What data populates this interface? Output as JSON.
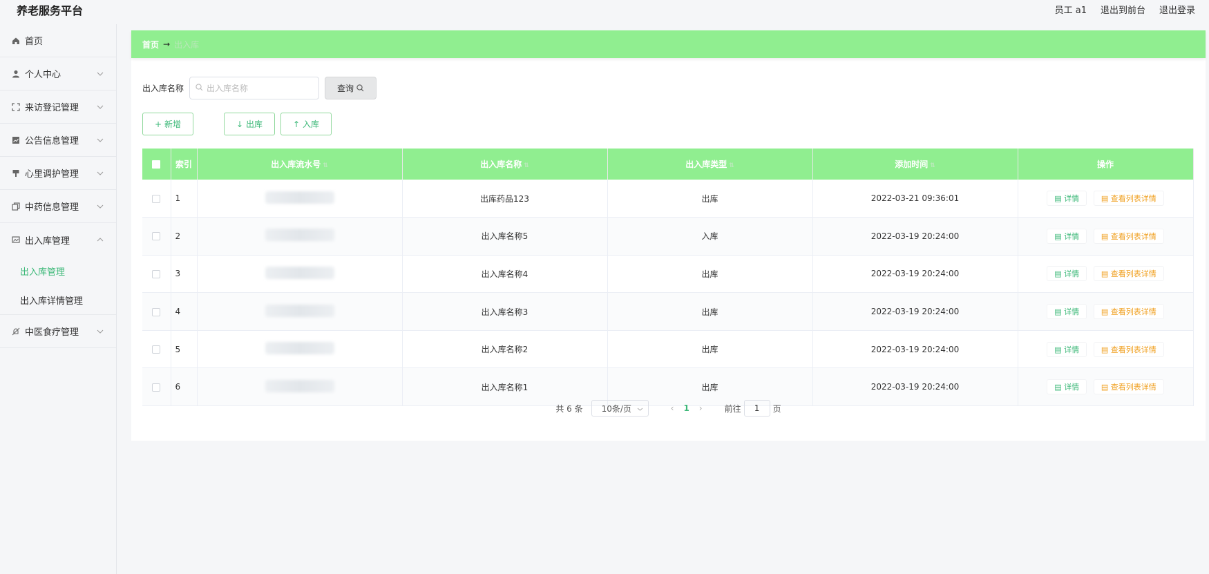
{
  "app": {
    "title": "养老服务平台",
    "user_label": "员工 a1",
    "front_link": "退出到前台",
    "logout_link": "退出登录"
  },
  "sidebar": {
    "items": [
      {
        "label": "首页",
        "icon": "home-icon"
      },
      {
        "label": "个人中心",
        "icon": "user-icon"
      },
      {
        "label": "来访登记管理",
        "icon": "fullscreen-icon"
      },
      {
        "label": "公告信息管理",
        "icon": "chart-icon"
      },
      {
        "label": "心里调护管理",
        "icon": "brush-icon"
      },
      {
        "label": "中药信息管理",
        "icon": "copy-icon"
      },
      {
        "label": "出入库管理",
        "icon": "picture-icon"
      },
      {
        "label": "中医食疗管理",
        "icon": "bell-off-icon"
      }
    ],
    "sub_items": [
      {
        "label": "出入库管理",
        "active": true
      },
      {
        "label": "出入库详情管理",
        "active": false
      }
    ]
  },
  "breadcrumb": {
    "home": "首页",
    "separator": "→",
    "current": "出入库"
  },
  "search": {
    "label": "出入库名称",
    "placeholder": "出入库名称",
    "value": "",
    "button": "查询"
  },
  "actions": {
    "add": "新增",
    "out": "出库",
    "in": "入库"
  },
  "table": {
    "headers": [
      "索引",
      "出入库流水号",
      "出入库名称",
      "出入库类型",
      "添加时间",
      "操作"
    ],
    "rows": [
      {
        "index": "1",
        "name": "出库药品123",
        "type": "出库",
        "time": "2022-03-21 09:36:01"
      },
      {
        "index": "2",
        "name": "出入库名称5",
        "type": "入库",
        "time": "2022-03-19 20:24:00"
      },
      {
        "index": "3",
        "name": "出入库名称4",
        "type": "出库",
        "time": "2022-03-19 20:24:00"
      },
      {
        "index": "4",
        "name": "出入库名称3",
        "type": "出库",
        "time": "2022-03-19 20:24:00"
      },
      {
        "index": "5",
        "name": "出入库名称2",
        "type": "出库",
        "time": "2022-03-19 20:24:00"
      },
      {
        "index": "6",
        "name": "出入库名称1",
        "type": "出库",
        "time": "2022-03-19 20:24:00"
      }
    ],
    "op_detail": "详情",
    "op_list": "查看列表详情"
  },
  "pager": {
    "total": "共 6 条",
    "page_size": "10条/页",
    "current_page": "1",
    "goto_prefix": "前往",
    "goto_value": "1",
    "goto_suffix": "页"
  },
  "colors": {
    "accent_green": "#90ee90",
    "link_green": "#3cb878",
    "orange": "#f0a020"
  }
}
